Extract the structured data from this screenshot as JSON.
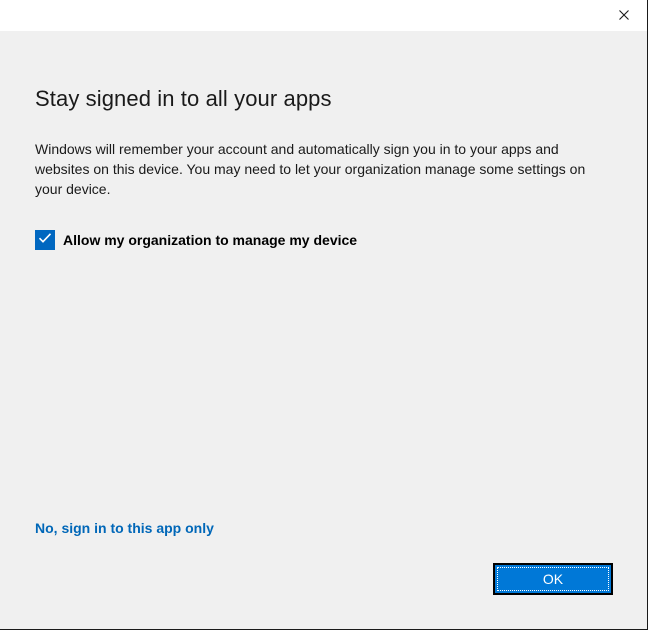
{
  "dialog": {
    "heading": "Stay signed in to all your apps",
    "description": "Windows will remember your account and automatically sign you in to your apps and websites on this device. You may need to let your organization manage some settings on your device.",
    "checkbox": {
      "label": "Allow my organization to manage my device",
      "checked": true
    },
    "link_text": "No, sign in to this app only",
    "ok_label": "OK"
  },
  "titlebar": {
    "close_icon": "close-icon"
  },
  "colors": {
    "background": "#f0f0f0",
    "accent": "#0078d7",
    "link": "#0067b8",
    "checkbox": "#0067c0"
  }
}
